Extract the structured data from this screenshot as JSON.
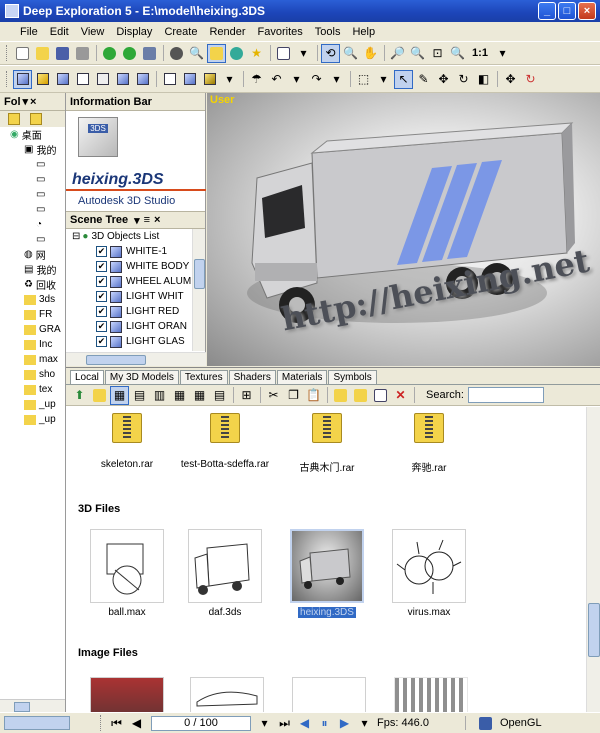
{
  "window": {
    "title": "Deep Exploration 5 - E:\\model\\heixing.3DS",
    "min": "_",
    "max": "□",
    "close": "×"
  },
  "menu": [
    "File",
    "Edit",
    "View",
    "Display",
    "Create",
    "Render",
    "Favorites",
    "Tools",
    "Help"
  ],
  "zoom_label": "1:1",
  "folders_panel": {
    "title": "Fol",
    "items": [
      "桌面",
      "我的",
      "我的",
      "网",
      "我的",
      "回收",
      "3ds",
      "FR",
      "GRA",
      "Inc",
      "max",
      "sho",
      "tex",
      "_up",
      "_up"
    ]
  },
  "info_bar": {
    "title": "Information Bar",
    "filename": "heixing.3DS",
    "format": "Autodesk 3D Studio",
    "badge": "3DS"
  },
  "scene_tree": {
    "title": "Scene Tree",
    "root": "3D Objects List",
    "items": [
      "WHITE-1",
      "WHITE BODY",
      "WHEEL ALUM",
      "LIGHT WHIT",
      "LIGHT RED",
      "LIGHT ORAN",
      "LIGHT GLAS"
    ]
  },
  "viewport": {
    "label": "User",
    "watermark": "http://heixing.net"
  },
  "tabs": [
    "Local",
    "My 3D Models",
    "Textures",
    "Shaders",
    "Materials",
    "Symbols"
  ],
  "search_label": "Search:",
  "archives": [
    "skeleton.rar",
    "test-Botta-sdeffa.rar",
    "古典木门.rar",
    "奔驰.rar"
  ],
  "sections": {
    "files3d": "3D Files",
    "images": "Image Files"
  },
  "files3d": [
    "ball.max",
    "daf.3ds",
    "heixing.3DS",
    "virus.max"
  ],
  "status": {
    "frame": "0 / 100",
    "fps": "Fps: 446.0",
    "renderer": "OpenGL"
  },
  "colors": {
    "titlebar": "#1c45b8",
    "selection": "#316ac5",
    "accent_stripe": "#7b97e6"
  }
}
